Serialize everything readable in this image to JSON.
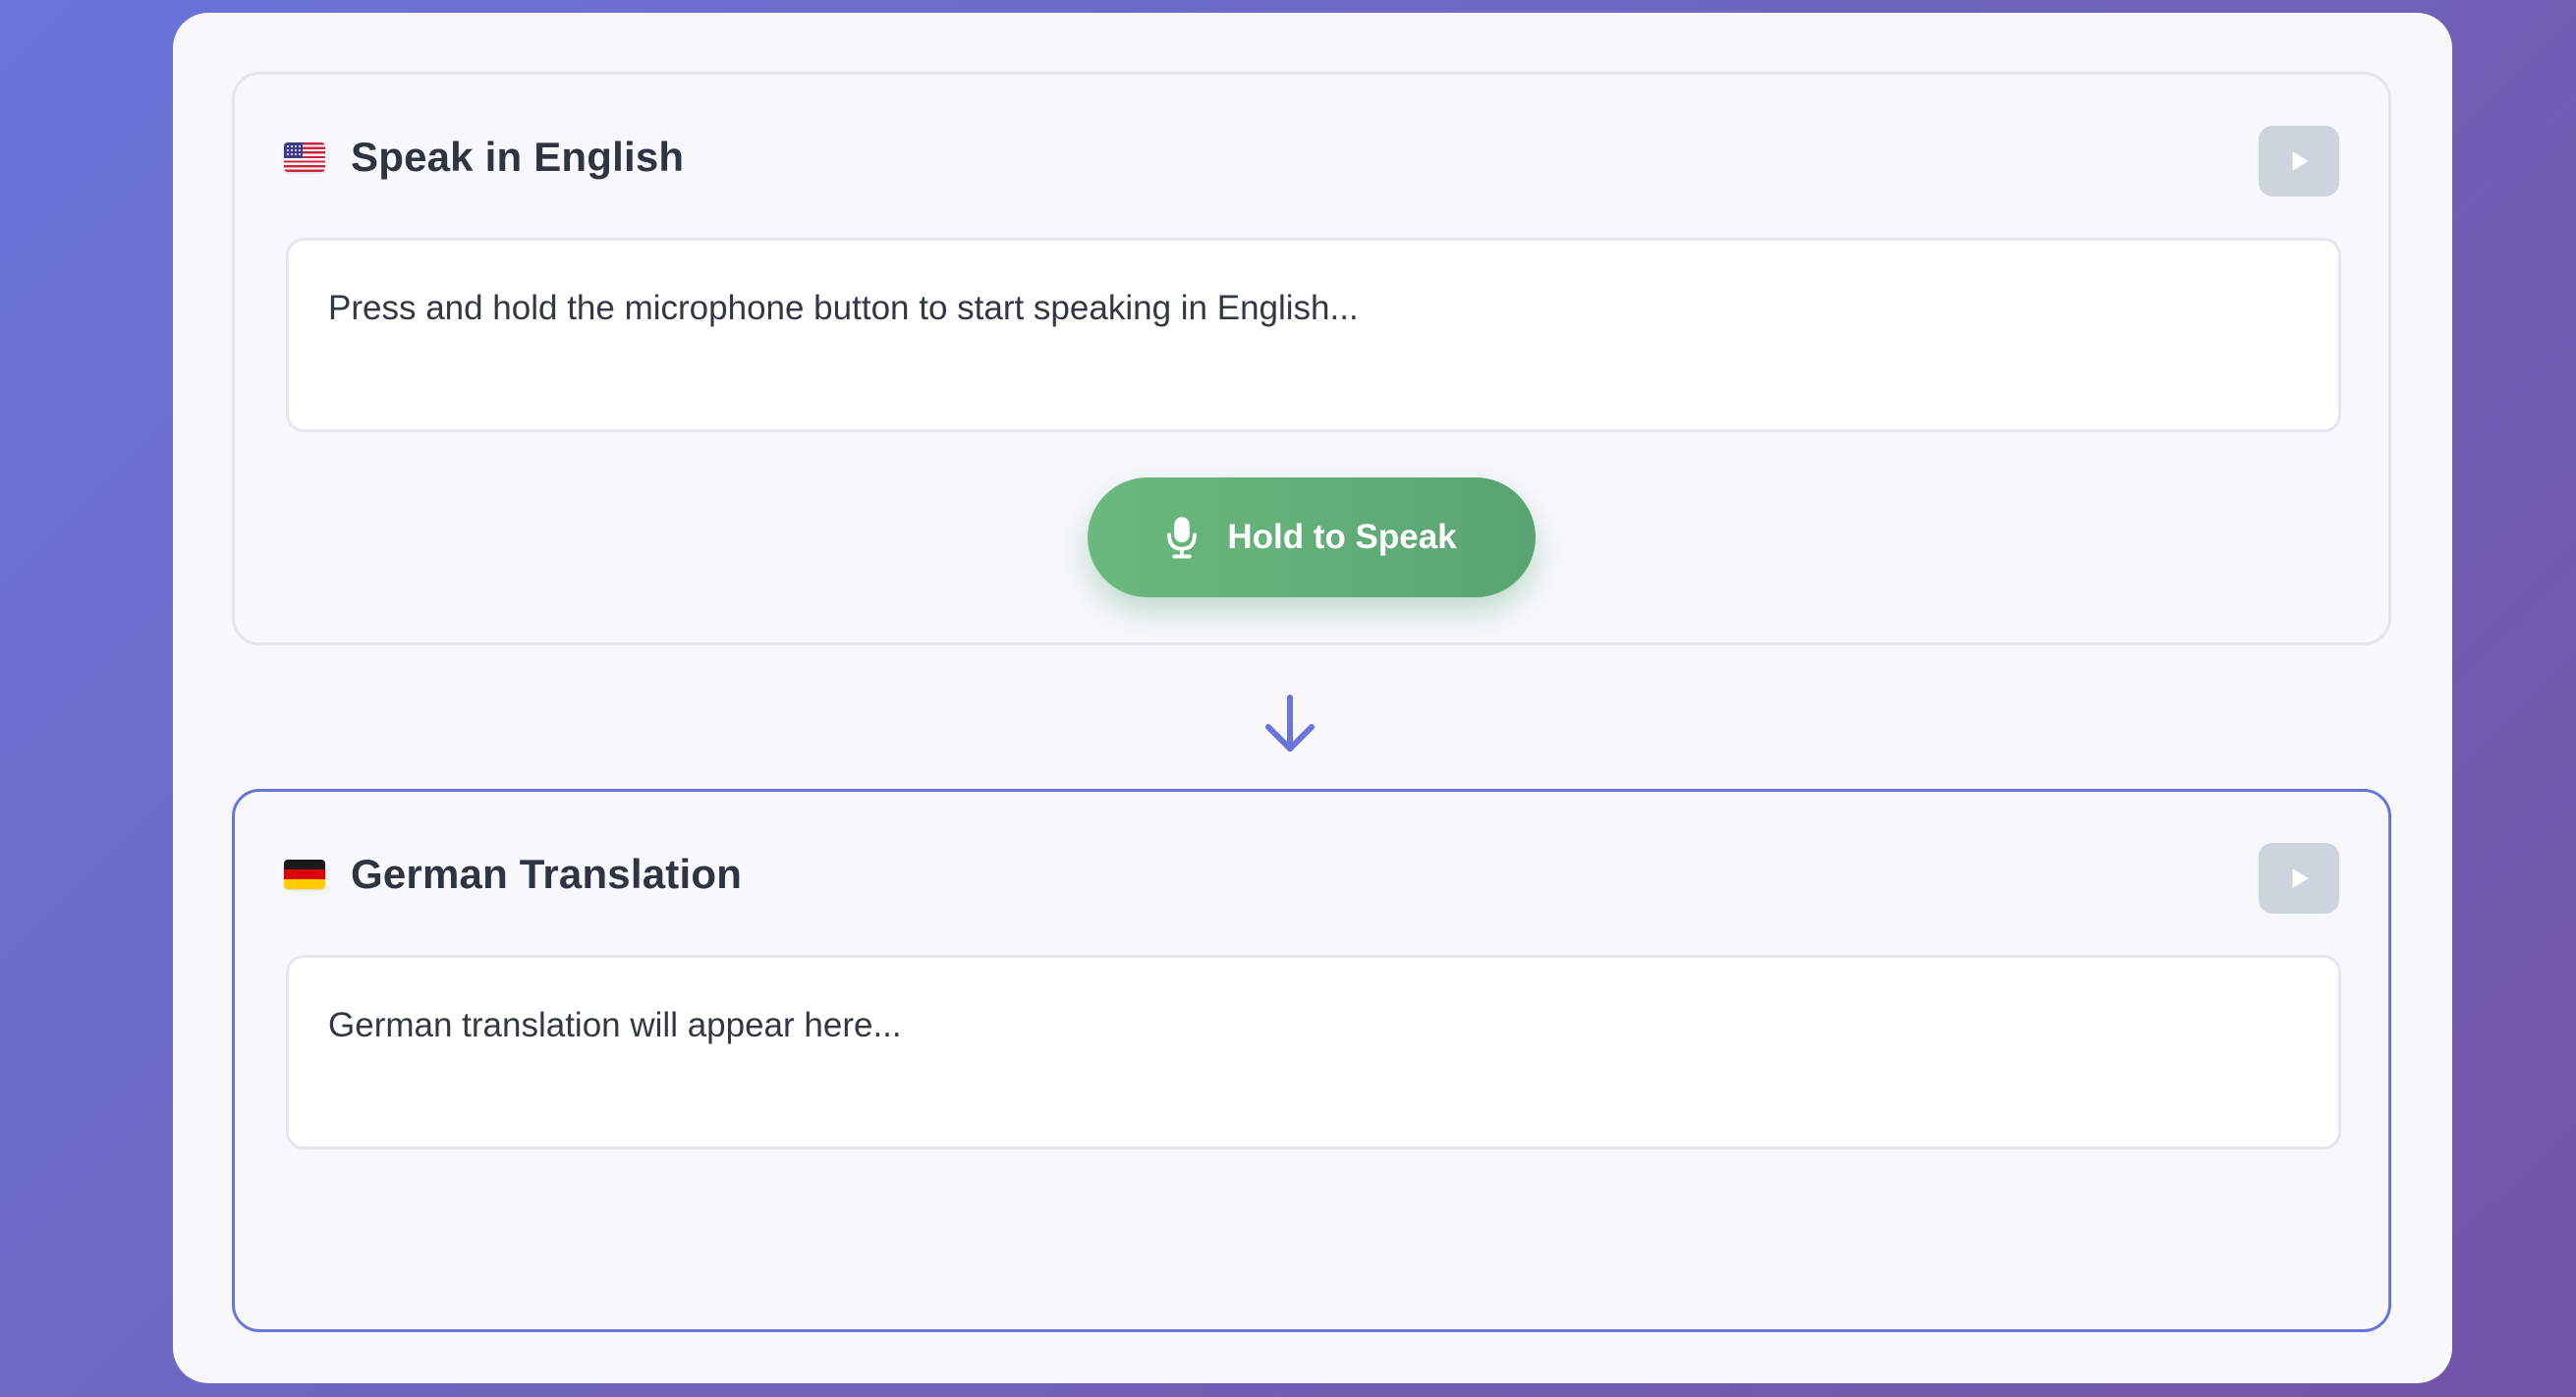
{
  "source_panel": {
    "flag_icon": "us-flag-icon",
    "title": "Speak in English",
    "play_icon": "play-icon",
    "placeholder_text": "Press and hold the microphone button to start speaking in English...",
    "hold_button": {
      "icon": "microphone-icon",
      "label": "Hold to Speak"
    }
  },
  "arrow_icon": "arrow-down-icon",
  "target_panel": {
    "flag_icon": "de-flag-icon",
    "title": "German Translation",
    "play_icon": "play-icon",
    "placeholder_text": "German translation will appear here..."
  },
  "colors": {
    "accent": "#6b74db",
    "button_green": "#5fae78",
    "play_button_bg": "#cdd4de"
  }
}
